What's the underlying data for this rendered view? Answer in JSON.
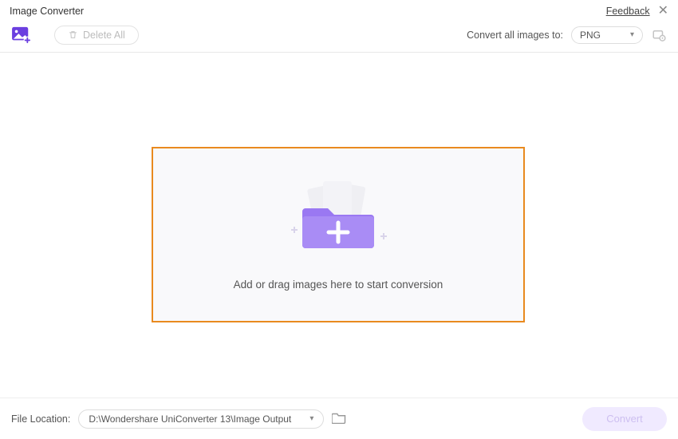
{
  "titlebar": {
    "title": "Image Converter",
    "feedback": "Feedback"
  },
  "toolbar": {
    "delete_all": "Delete All",
    "convert_all_label": "Convert all images to:",
    "format_selected": "PNG"
  },
  "dropzone": {
    "hint": "Add or drag images here to start conversion"
  },
  "footer": {
    "file_location_label": "File Location:",
    "path": "D:\\Wondershare UniConverter 13\\Image Output",
    "convert": "Convert"
  }
}
